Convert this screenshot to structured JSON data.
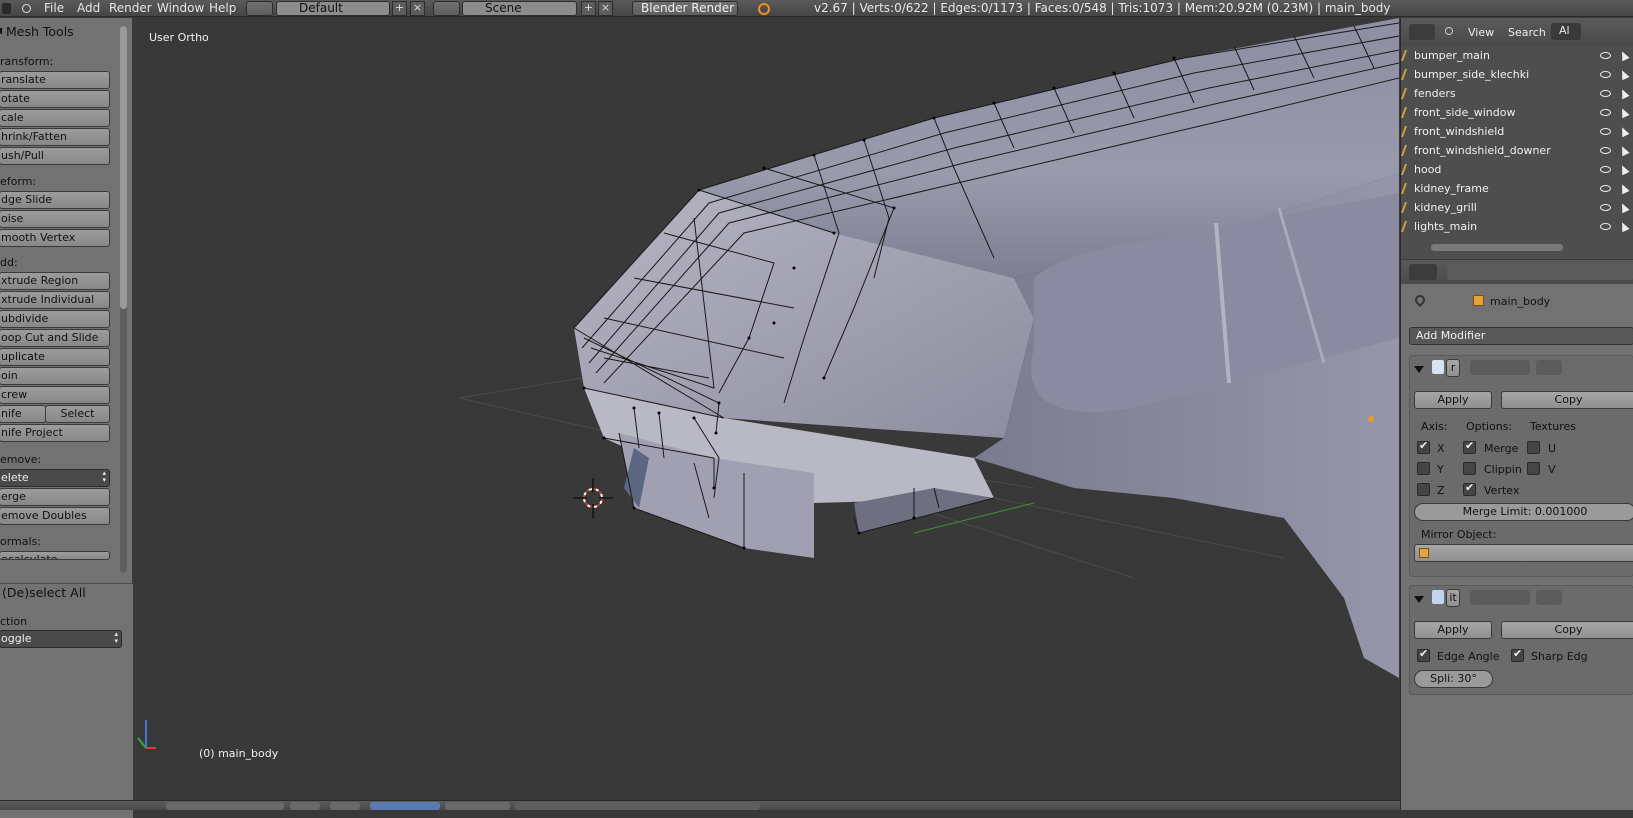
{
  "menu": [
    "File",
    "Add",
    "Render",
    "Window",
    "Help"
  ],
  "screen_layout": "Default",
  "scene": "Scene",
  "render_engine": "Blender Render",
  "info_bar": "v2.67 | Verts:0/622 | Edges:0/1173 | Faces:0/548 | Tris:1073 | Mem:20.92M (0.23M) | main_body",
  "toolshelf": {
    "title": "Mesh Tools",
    "transform_label": "ransform:",
    "transform": [
      "ranslate",
      "otate",
      "cale",
      "hrink/Fatten",
      "ush/Pull"
    ],
    "deform_label": "eform:",
    "deform": [
      "dge Slide",
      "oise",
      "mooth Vertex"
    ],
    "add_label": "dd:",
    "add": [
      "xtrude Region",
      "xtrude Individual",
      "ubdivide",
      "oop Cut and Slide",
      "uplicate",
      "oin",
      "crew"
    ],
    "knife": "nife",
    "select": "Select",
    "knife_project": "nife Project",
    "remove_label": "emove:",
    "delete": "elete",
    "remove": [
      "erge",
      "emove Doubles"
    ],
    "normals_label": "ormals:",
    "normals_partial": "ecalculate"
  },
  "operator_panel": {
    "title": "(De)select All",
    "action_label": "ction",
    "action_value": "oggle"
  },
  "viewport": {
    "view_label": "User Ortho",
    "object_label": "(0) main_body"
  },
  "outliner": {
    "view": "View",
    "search": "Search",
    "filter": "Al",
    "rows": [
      "bumper_main",
      "bumper_side_klechki",
      "fenders",
      "front_side_window",
      "front_windshield",
      "front_windshield_downer",
      "hood",
      "kidney_frame",
      "kidney_grill",
      "lights_main"
    ]
  },
  "properties": {
    "object_name": "main_body",
    "add_modifier": "Add Modifier",
    "mirror": {
      "name_field": "r",
      "apply": "Apply",
      "copy": "Copy",
      "axis_label": "Axis:",
      "options_label": "Options:",
      "textures_label": "Textures",
      "axes": [
        {
          "label": "X",
          "checked": true
        },
        {
          "label": "Y",
          "checked": false
        },
        {
          "label": "Z",
          "checked": false
        }
      ],
      "options": [
        {
          "label": "Merge",
          "checked": true
        },
        {
          "label": "Clippin",
          "checked": false
        },
        {
          "label": "Vertex",
          "checked": true
        }
      ],
      "textures": [
        {
          "label": "U",
          "checked": false
        },
        {
          "label": "V",
          "checked": false
        }
      ],
      "merge_limit": "Merge Limit: 0.001000",
      "mirror_object_label": "Mirror Object:"
    },
    "edge_split": {
      "name_field": "it",
      "apply": "Apply",
      "copy": "Copy",
      "edge_angle": "Edge Angle",
      "edge_angle_checked": true,
      "sharp_edges": "Sharp Edg",
      "sharp_edges_checked": true,
      "split_angle": "Spli: 30°"
    }
  },
  "colors": {
    "viewport_bg": "#393939",
    "mesh_fill": "#8f8fa6",
    "panel_bg": "#727272",
    "header_bg": "#4e4e4e",
    "accent_orange": "#e89a2c"
  }
}
